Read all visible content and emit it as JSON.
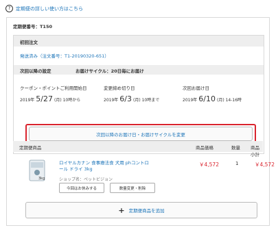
{
  "help": {
    "icon_glyph": "?",
    "link_text": "定期便の詳しい使い方はこちら"
  },
  "subscription": {
    "number_label": "定期便番号：T150"
  },
  "first_order": {
    "heading": "初回注文",
    "status": "発送済み（注文番号：T1-20190320-651）"
  },
  "next_delivery": {
    "setting_label": "次回以降の設定",
    "cycle_label": "お届けサイクル：20日毎にお届け"
  },
  "dates": [
    {
      "label": "クーポン・ポイントご利用開始日",
      "year": "2019年",
      "date": "5/27",
      "suffix": "(月) 10時から"
    },
    {
      "label": "変更締め切り日",
      "year": "2019年",
      "date": "6/3",
      "suffix": "(月) 10時まで"
    },
    {
      "label": "次回お届け日",
      "year": "2019年",
      "date": "6/10",
      "suffix": "(月) 14-16時"
    }
  ],
  "change_button": "次回以降のお届け日・お届けサイクルを変更",
  "products": {
    "heading": "定期便商品",
    "columns": {
      "price": "商品価格",
      "qty": "数量",
      "subtotal": "商品小計"
    },
    "items": [
      {
        "name": "ロイヤルカナン 食事療法食 犬用 phコントロール ドライ 3kg",
        "shop": "ショップ名：ペットビジョン",
        "price": "￥4,572",
        "qty": "1",
        "subtotal": "￥4,572",
        "skip_button": "今回はお休みする",
        "edit_button": "数量変更・削除",
        "package_label": "3kg"
      }
    ]
  },
  "add_button": {
    "plus": "+",
    "label": "定期便商品を追加"
  },
  "colors": {
    "link": "#1a73b8",
    "price": "#d9232d",
    "highlight": "#d9232d"
  }
}
